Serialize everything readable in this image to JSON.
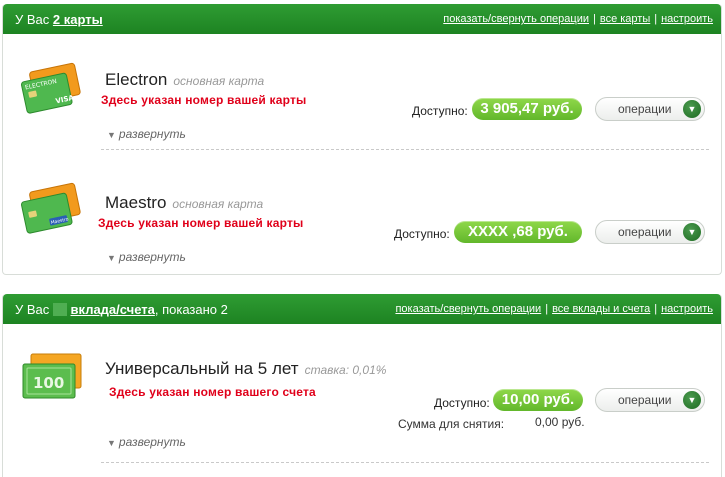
{
  "cards_panel": {
    "title_prefix": "У Вас",
    "title_link": "2 карты",
    "links": [
      "показать/свернуть операции",
      "все карты",
      "настроить"
    ],
    "items": [
      {
        "name": "Electron",
        "type": "основная карта",
        "note": "Здесь указан номер вашей карты",
        "available_label": "Доступно:",
        "balance": "3 905,47 руб.",
        "ops_label": "операции",
        "expand_label": "развернуть",
        "card_text": "ELECTRON",
        "brand_text": "VISA"
      },
      {
        "name": "Maestro",
        "type": "основная карта",
        "note": "Здесь указан номер вашей карты",
        "available_label": "Доступно:",
        "balance": "XXXX ,68 руб.",
        "ops_label": "операции",
        "expand_label": "развернуть",
        "brand_text": "Maestro"
      }
    ]
  },
  "deposits_panel": {
    "title_prefix": "У Вас",
    "title_link": "вклада/счета",
    "title_suffix": ", показано 2",
    "links": [
      "показать/свернуть операции",
      "все вклады и счета",
      "настроить"
    ],
    "items": [
      {
        "name": "Универсальный на 5 лет",
        "type": "ставка: 0,01%",
        "note": "Здесь указан номер вашего счета",
        "available_label": "Доступно:",
        "balance": "10,00 руб.",
        "ops_label": "операции",
        "sum_label": "Сумма для снятия:",
        "sum_value": "0,00 руб.",
        "expand_label": "развернуть",
        "banknote_text": "100"
      }
    ]
  },
  "colors": {
    "header_green": "#2f9c33",
    "balance_green": "#62b72b",
    "note_red": "#e0001a"
  }
}
